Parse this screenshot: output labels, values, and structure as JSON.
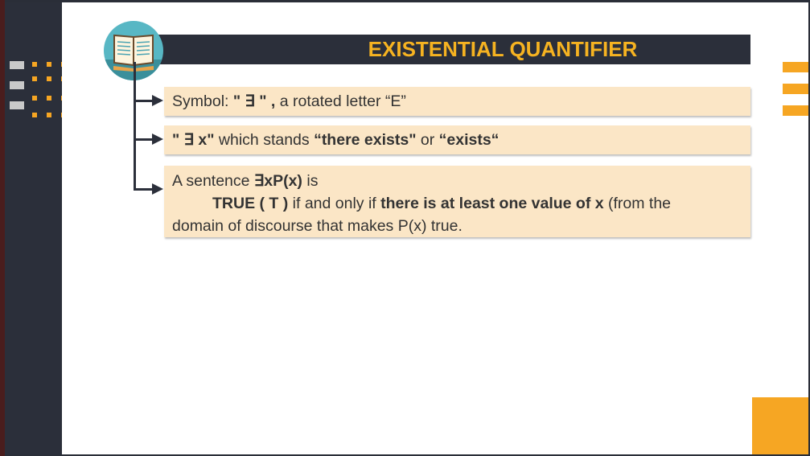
{
  "slide": {
    "title": "EXISTENTIAL QUANTIFIER",
    "bullets": {
      "b1": {
        "prefix": "Symbol: ",
        "symbol": "\" ∃ \" ,",
        "suffix": " a rotated letter “E”"
      },
      "b2": {
        "symbol": "\" ∃ x\"",
        "mid": " which stands ",
        "phrase1": "“there exists\"",
        "or": " or ",
        "phrase2": "“exists“"
      },
      "b3": {
        "line1_prefix": "A sentence  ",
        "line1_expr": "∃xP(x)",
        "line1_suffix": " is",
        "line2_true": "TRUE ( T )",
        "line2_mid": " if and only if ",
        "line2_bold": "there is at least one value of x",
        "line2_end": " (from the",
        "line3": "domain of discourse that makes P(x) true."
      }
    }
  },
  "colors": {
    "navy": "#2b2f3a",
    "accent": "#f6a623",
    "title_text": "#f6b321",
    "box_fill": "#fbe6c6"
  },
  "icons": [
    "book-icon"
  ]
}
